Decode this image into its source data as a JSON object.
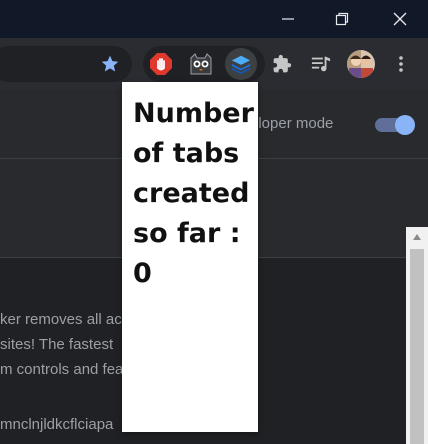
{
  "window": {
    "controls": {
      "minimize_icon": "minimize-icon",
      "maximize_icon": "restore-icon",
      "close_icon": "close-icon"
    }
  },
  "toolbar": {
    "bookmark_icon": "star-icon",
    "extensions": [
      {
        "name": "adblock-extension-icon",
        "color": "#e0382c"
      },
      {
        "name": "cat-extension-icon"
      },
      {
        "name": "tab-counter-extension-icon",
        "color": "#1a73e8",
        "active": true
      }
    ],
    "puzzle_icon": "puzzle-icon",
    "media_icon": "media-control-icon",
    "menu_icon": "kebab-menu-icon"
  },
  "extensions_page": {
    "developer_mode_label": "eloper mode",
    "developer_mode_on": true,
    "description_lines": [
      "ker removes all ac",
      "sites! The fastest",
      "m controls and fea"
    ],
    "extension_id": "mnclnjldkcflciapa"
  },
  "popup": {
    "text": "Number of tabs created so far : 0"
  },
  "colors": {
    "accent": "#8ab4f8",
    "bookmark_star": "#8ab4f8"
  }
}
